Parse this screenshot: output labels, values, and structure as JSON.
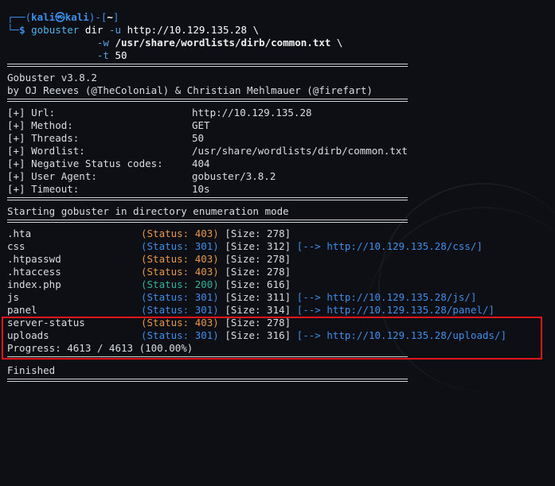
{
  "prompt": {
    "user": "kali",
    "at_symbol": "㉿",
    "host": "kali",
    "dir": "~",
    "dollar": "$"
  },
  "command": {
    "line1": "gobuster dir -u http://10.129.135.28 \\",
    "tool": "gobuster",
    "args1": " dir ",
    "flag_u": "-u",
    "url": " http://10.129.135.28 \\",
    "flag_w": "-w",
    "wordlist": " /usr/share/wordlists/dirb/common.txt",
    "cont": " \\",
    "flag_t": "-t",
    "threads": " 50"
  },
  "banner": {
    "version": "Gobuster v3.8.2",
    "authors": "by OJ Reeves (@TheColonial) & Christian Mehlmauer (@firefart)"
  },
  "config": [
    {
      "key": "[+] Url:",
      "value": "http://10.129.135.28"
    },
    {
      "key": "[+] Method:",
      "value": "GET"
    },
    {
      "key": "[+] Threads:",
      "value": "50"
    },
    {
      "key": "[+] Wordlist:",
      "value": "/usr/share/wordlists/dirb/common.txt"
    },
    {
      "key": "[+] Negative Status codes:",
      "value": "404"
    },
    {
      "key": "[+] User Agent:",
      "value": "gobuster/3.8.2"
    },
    {
      "key": "[+] Timeout:",
      "value": "10s"
    }
  ],
  "start_message": "Starting gobuster in directory enumeration mode",
  "results": [
    {
      "path": ".hta",
      "status": "(Status: 403)",
      "code": "403",
      "size": "[Size: 278]",
      "redirect": ""
    },
    {
      "path": "css",
      "status": "(Status: 301)",
      "code": "301",
      "size": "[Size: 312]",
      "redirect": "[--> http://10.129.135.28/css/]"
    },
    {
      "path": ".htpasswd",
      "status": "(Status: 403)",
      "code": "403",
      "size": "[Size: 278]",
      "redirect": ""
    },
    {
      "path": ".htaccess",
      "status": "(Status: 403)",
      "code": "403",
      "size": "[Size: 278]",
      "redirect": ""
    },
    {
      "path": "index.php",
      "status": "(Status: 200)",
      "code": "200",
      "size": "[Size: 616]",
      "redirect": ""
    },
    {
      "path": "js",
      "status": "(Status: 301)",
      "code": "301",
      "size": "[Size: 311]",
      "redirect": "[--> http://10.129.135.28/js/]"
    },
    {
      "path": "panel",
      "status": "(Status: 301)",
      "code": "301",
      "size": "[Size: 314]",
      "redirect": "[--> http://10.129.135.28/panel/]"
    },
    {
      "path": "server-status",
      "status": "(Status: 403)",
      "code": "403",
      "size": "[Size: 278]",
      "redirect": ""
    },
    {
      "path": "uploads",
      "status": "(Status: 301)",
      "code": "301",
      "size": "[Size: 316]",
      "redirect": "[--> http://10.129.135.28/uploads/]"
    }
  ],
  "progress": "Progress: 4613 / 4613 (100.00%)",
  "finished": "Finished",
  "colors": {
    "background": "#0d0f14",
    "prompt_blue": "#3d8ee8",
    "status_403": "#e5964a",
    "status_200": "#2fb39a",
    "status_301": "#3d8ee8",
    "highlight_box": "#e0161c"
  }
}
